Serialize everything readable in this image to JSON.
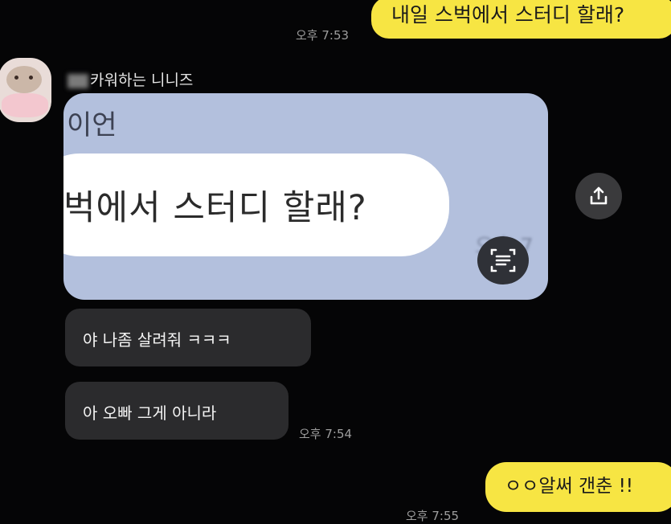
{
  "messages": {
    "m1_text": "내일 스벅에서 스터디 할래?",
    "m1_time": "오후 7:53",
    "sender_name": "카워하는 니니즈",
    "image_top_text": "이언",
    "image_main_text": "벅에서 스터디 할래?",
    "image_blur_time": "오후 7",
    "m2_text": "야 나좀 살려줘 ㅋㅋㅋ",
    "m3_text": "아 오빠 그게 아니라",
    "m3_time": "오후 7:54",
    "m4_text": "ㅇㅇ알써 갠춘 !!",
    "m4_time": "오후 7:55"
  },
  "colors": {
    "background": "#050506",
    "my_bubble": "#f7e543",
    "other_bubble": "#2b2b2d",
    "image_bg": "#b3c0dd"
  },
  "icons": {
    "share": "share-icon",
    "scan": "scan-text-icon",
    "avatar": "profile-avatar"
  }
}
